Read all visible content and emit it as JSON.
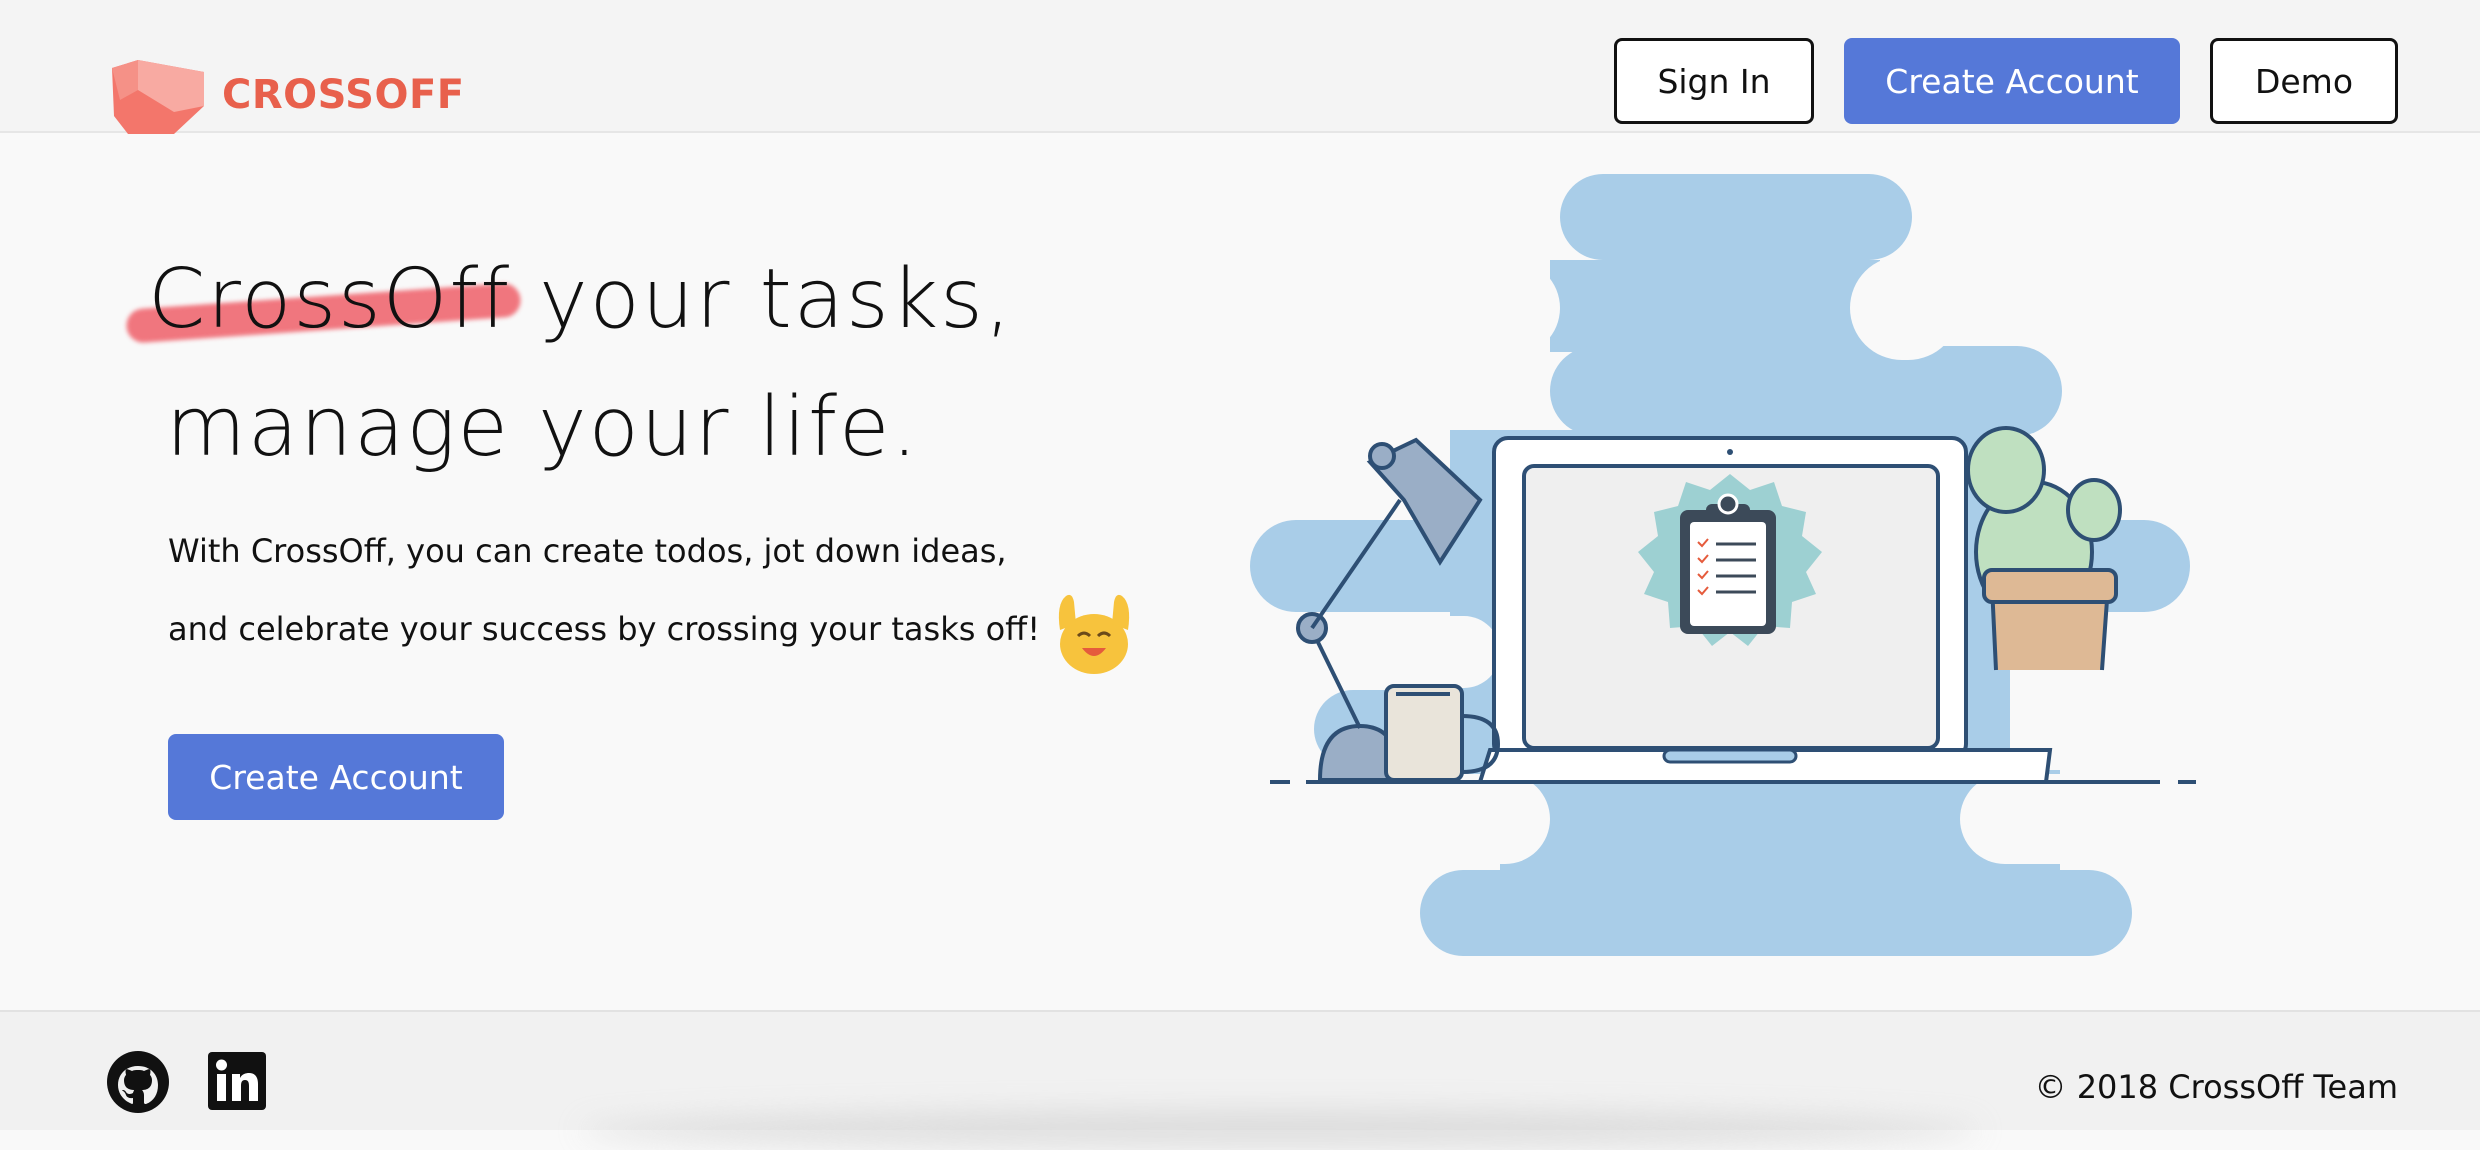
{
  "header": {
    "brand": "CROSSOFF",
    "sign_in_label": "Sign In",
    "create_account_label": "Create Account",
    "demo_label": "Demo"
  },
  "hero": {
    "crossed_word": "CrossOff",
    "headline_rest": " your tasks,",
    "headline_line2": "manage your life.",
    "paragraph_line1": "With CrossOff, you can create todos, jot down ideas,",
    "paragraph_line2": "and celebrate your success by crossing your tasks off!",
    "cta_label": "Create Account",
    "emoji": "raising-hands-emoji"
  },
  "footer": {
    "copyright": "© 2018 CrossOff Team",
    "icons": [
      "github-icon",
      "linkedin-icon"
    ]
  },
  "colors": {
    "brand": "#e8604c",
    "primary_button": "#5578d8",
    "strike": "#ef5a64",
    "illustration_blob": "#a9cde8"
  }
}
